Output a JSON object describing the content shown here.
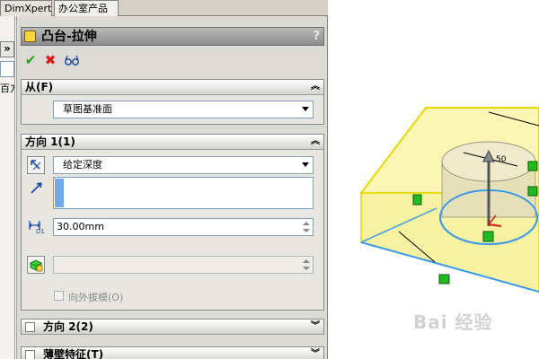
{
  "tabs": [
    {
      "label": "DimXpert"
    },
    {
      "label": "办公室产品"
    }
  ],
  "left_stub": {
    "expand_label": "»",
    "partial_text": "百方"
  },
  "property_manager": {
    "title": "凸台-拉伸",
    "help": "?",
    "groups": {
      "from": {
        "title": "从(F)",
        "start_condition": "草图基准面"
      },
      "direction1": {
        "title": "方向 1(1)",
        "end_condition": "给定深度",
        "depth": "30.00mm",
        "depth_icon_label": "D1",
        "draft_outward_label": "向外拔模(O)"
      },
      "direction2": {
        "title": "方向 2(2)"
      },
      "thin_feature": {
        "title": "薄壁特征(T)"
      }
    }
  },
  "graphics": {
    "dimension_label": "50",
    "watermark": "Bai 经验"
  },
  "colors": {
    "body_face": "#fbf6b4",
    "edge_yellow": "#e6d800",
    "edge_blue": "#3f9be5",
    "handle_green": "#22bb22"
  }
}
